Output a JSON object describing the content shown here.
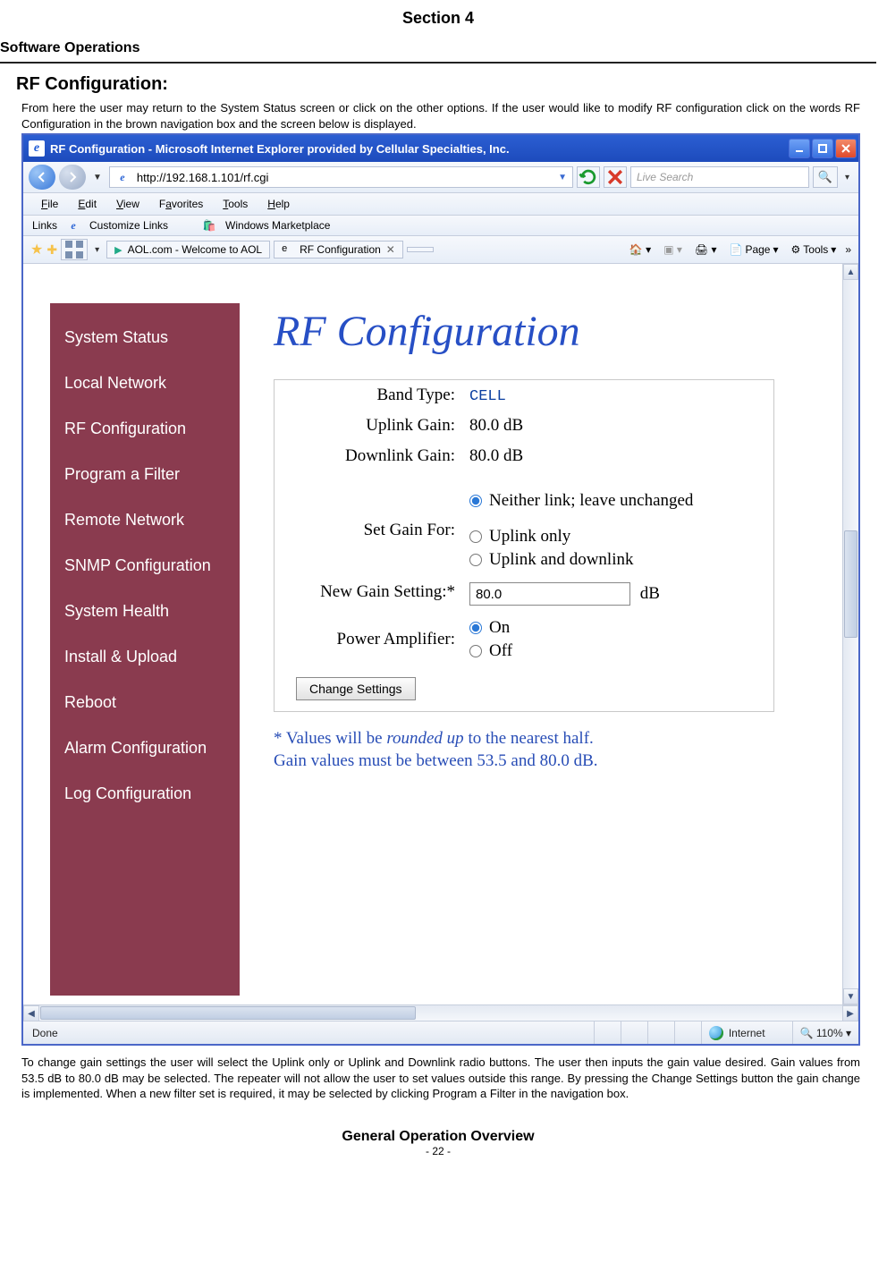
{
  "doc": {
    "section": "Section 4",
    "page_title": "Software Operations",
    "subhead": "RF Configuration:",
    "intro": "From here the user may return to the System Status screen or click on the other options. If the user would like to modify RF configuration click on the words RF Configuration in the brown navigation box and the screen below is displayed.",
    "outro": "To change gain settings the user will select the Uplink only or Uplink and Downlink radio buttons. The user then inputs the gain value desired. Gain values from 53.5 dB to 80.0 dB may be selected. The repeater will not allow the user to set values outside this range. By pressing the Change Settings button the gain change is implemented.  When a new filter set is required, it may be selected by clicking Program a Filter in the navigation box.",
    "footer_title": "General Operation Overview",
    "footer_page": "- 22 -"
  },
  "browser": {
    "title": "RF Configuration - Microsoft Internet Explorer provided by Cellular Specialties, Inc.",
    "url": "http://192.168.1.101/rf.cgi",
    "search_placeholder": "Live Search",
    "menus": {
      "file": "File",
      "edit": "Edit",
      "view": "View",
      "favorites": "Favorites",
      "tools": "Tools",
      "help": "Help"
    },
    "links_label": "Links",
    "links": {
      "customize": "Customize Links",
      "marketplace": "Windows Marketplace"
    },
    "tabs": {
      "aol": "AOL.com - Welcome to AOL",
      "rfconfig": "RF Configuration"
    },
    "tools_menu": {
      "page": "Page",
      "tools": "Tools"
    },
    "status": {
      "left": "Done",
      "zone": "Internet",
      "zoom": "110%"
    }
  },
  "page": {
    "nav": {
      "items": [
        "System Status",
        "Local Network",
        "RF  Configuration",
        "Program a Filter",
        "Remote Network",
        "SNMP  Configuration",
        "System Health",
        "Install & Upload",
        "Reboot",
        "Alarm Configuration",
        "Log Configuration"
      ]
    },
    "heading": "RF Configuration",
    "fields": {
      "band_label": "Band Type:",
      "band_value": "CELL",
      "uplink_label": "Uplink Gain:",
      "uplink_value": "80.0 dB",
      "downlink_label": "Downlink Gain:",
      "downlink_value": "80.0 dB",
      "setgain_label": "Set Gain For:",
      "setgain_opts": {
        "neither": "Neither link; leave unchanged",
        "uplink": "Uplink only",
        "both": "Uplink and downlink"
      },
      "newgain_label": "New Gain Setting:*",
      "newgain_value": "80.0",
      "newgain_unit": "dB",
      "pa_label": "Power Amplifier:",
      "pa_opts": {
        "on": "On",
        "off": "Off"
      },
      "change_btn": "Change Settings"
    },
    "note_l1": "* Values will be rounded up to the nearest half.",
    "note_l2": "Gain values must be between 53.5 and 80.0 dB."
  }
}
